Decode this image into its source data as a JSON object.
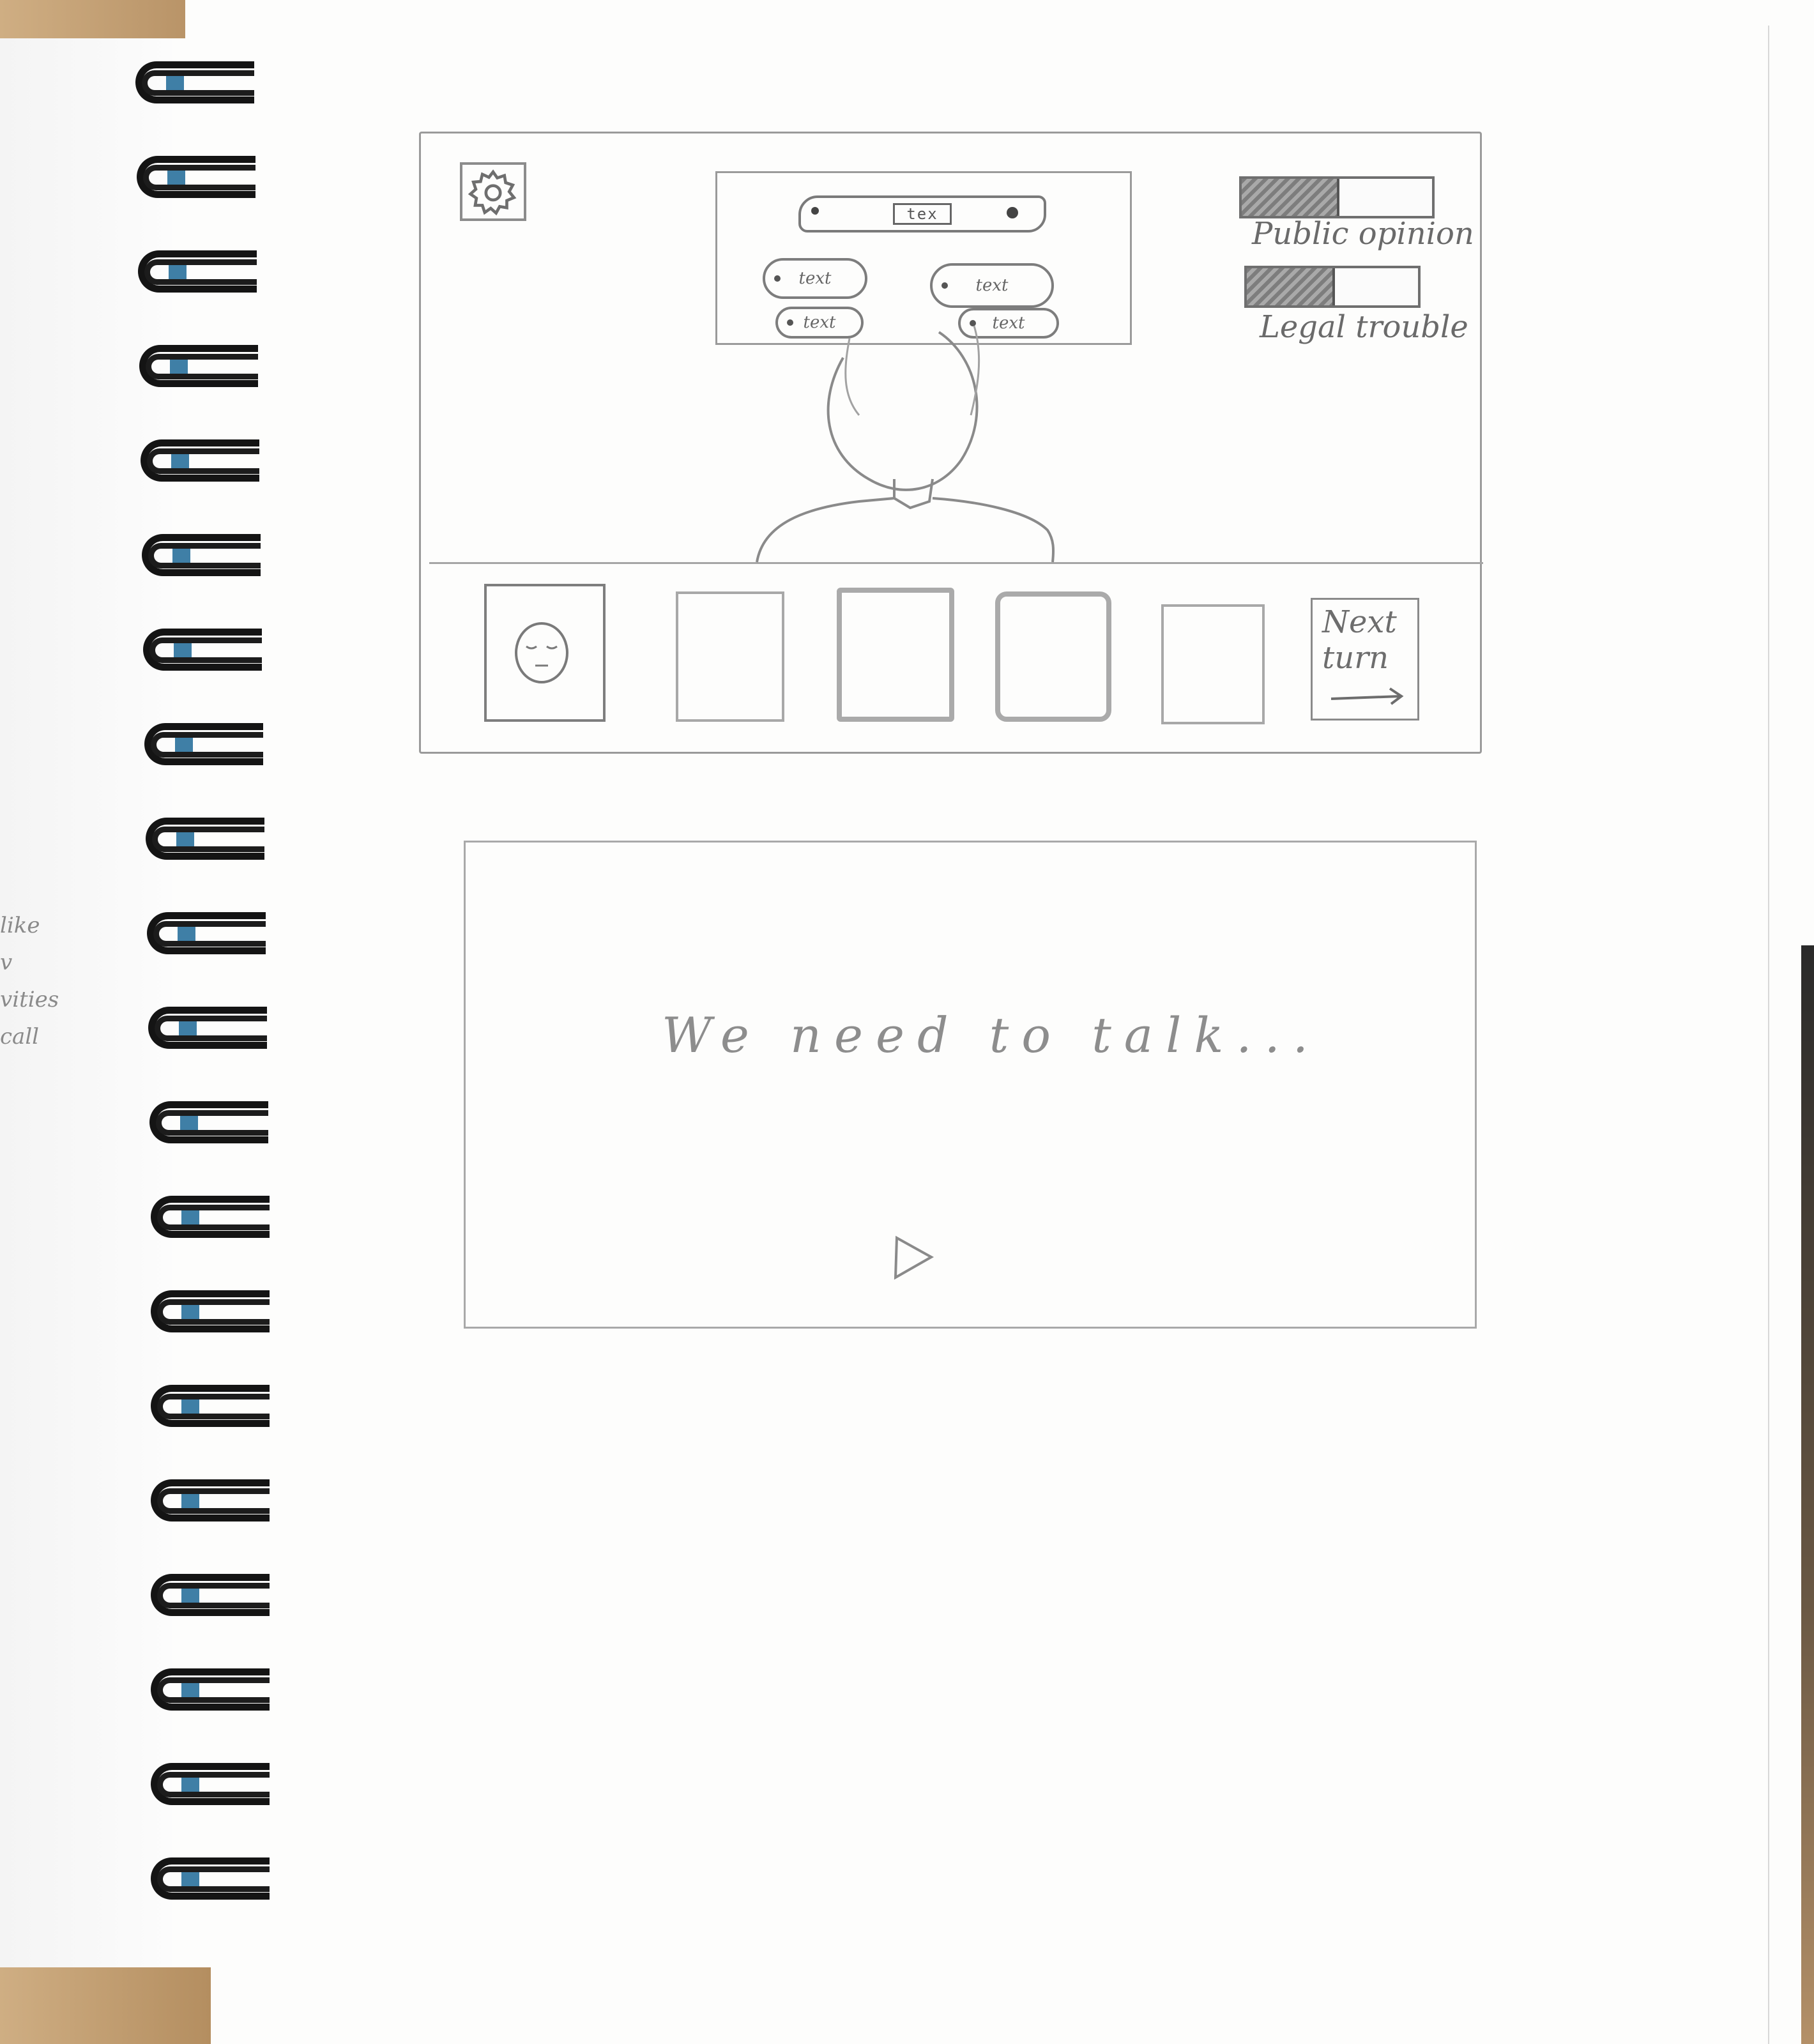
{
  "sketch": {
    "margin_note": [
      "like",
      "v",
      "vities",
      "call"
    ],
    "game_screen": {
      "settings_icon": "gear-icon",
      "dialogue": {
        "speech_text": "tex",
        "choices": [
          "text",
          "text",
          "text",
          "text"
        ]
      },
      "meters": [
        {
          "label": "Public opinion",
          "level": 0.5
        },
        {
          "label": "Legal trouble",
          "level": 0.5
        }
      ],
      "cards": {
        "portrait_icon": "sleepy-face-icon",
        "empty_slots": 4
      },
      "next_turn": {
        "label": "Next\nturn",
        "icon": "arrow-right-icon"
      }
    },
    "dialogue_screen": {
      "line": "We need to talk...",
      "advance_icon": "play-triangle-icon"
    }
  }
}
